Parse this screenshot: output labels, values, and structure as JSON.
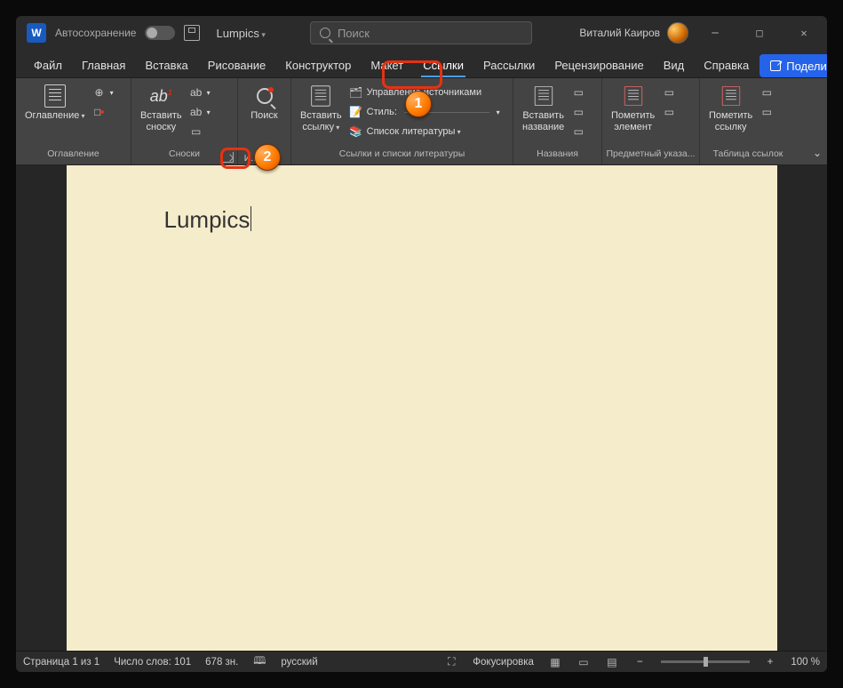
{
  "titlebar": {
    "autosave_label": "Автосохранение",
    "doc_name": "Lumpics",
    "search_placeholder": "Поиск",
    "user_name": "Виталий Каиров"
  },
  "tabs": {
    "file": "Файл",
    "home": "Главная",
    "insert": "Вставка",
    "draw": "Рисование",
    "design": "Конструктор",
    "layout": "Макет",
    "references": "Ссылки",
    "mailings": "Рассылки",
    "review": "Рецензирование",
    "view": "Вид",
    "help": "Справка",
    "share": "Поделиться"
  },
  "ribbon": {
    "toc": {
      "btn": "Оглавление",
      "group": "Оглавление"
    },
    "footnotes": {
      "insert": "Вставить\nсноску",
      "group": "Сноски",
      "extra": "И..."
    },
    "research": {
      "search": "Поиск"
    },
    "citations": {
      "insert": "Вставить\nссылку",
      "manage": "Управление источниками",
      "style": "Стиль:",
      "biblio": "Список литературы",
      "group": "Ссылки и списки литературы"
    },
    "captions": {
      "insert": "Вставить\nназвание",
      "group": "Названия"
    },
    "index": {
      "mark": "Пометить\nэлемент",
      "group": "Предметный указа..."
    },
    "toa": {
      "mark": "Пометить\nссылку",
      "group": "Таблица ссылок"
    }
  },
  "document": {
    "text": "Lumpics"
  },
  "statusbar": {
    "page": "Страница 1 из 1",
    "words": "Число слов: 101",
    "chars": "678 зн.",
    "lang": "русский",
    "focus": "Фокусировка",
    "zoom": "100 %"
  },
  "callouts": {
    "one": "1",
    "two": "2"
  }
}
